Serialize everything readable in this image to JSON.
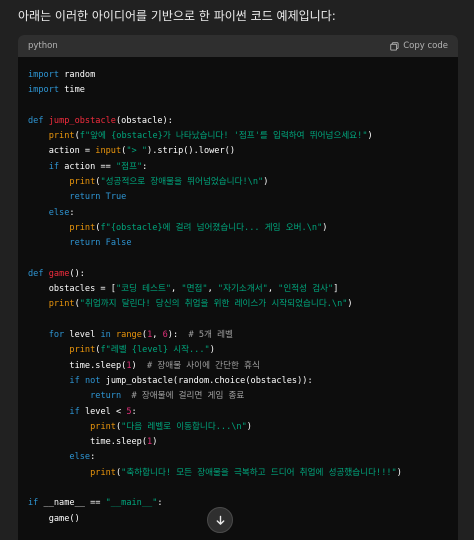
{
  "intro": "아래는 이러한 아이디어를 기반으로 한 파이썬 코드 예제입니다:",
  "code_header": {
    "language": "python",
    "copy_label": "Copy code"
  },
  "icons": {
    "copy": "copy-icon",
    "scroll_down": "arrow-down-icon"
  },
  "colors": {
    "keyword": "#2e95d3",
    "function": "#f22c3d",
    "string": "#00a67d",
    "number": "#df3079",
    "builtin": "#e9950c",
    "comment": "#a0a0a0",
    "code_bg": "#0d0d0d",
    "header_bg": "#2f2f2f"
  },
  "code_lines": [
    [
      {
        "t": "kw",
        "v": "import"
      },
      {
        "t": "pl",
        "v": " random"
      }
    ],
    [
      {
        "t": "kw",
        "v": "import"
      },
      {
        "t": "pl",
        "v": " time"
      }
    ],
    [],
    [
      {
        "t": "kw",
        "v": "def"
      },
      {
        "t": "pl",
        "v": " "
      },
      {
        "t": "fn",
        "v": "jump_obstacle"
      },
      {
        "t": "pl",
        "v": "(obstacle):"
      }
    ],
    [
      {
        "t": "pl",
        "v": "    "
      },
      {
        "t": "bi",
        "v": "print"
      },
      {
        "t": "pl",
        "v": "("
      },
      {
        "t": "str",
        "v": "f\"앞에 {obstacle}가 나타났습니다! '점프'를 입력하여 뛰어넘으세요!\""
      },
      {
        "t": "pl",
        "v": ")"
      }
    ],
    [
      {
        "t": "pl",
        "v": "    action = "
      },
      {
        "t": "bi",
        "v": "input"
      },
      {
        "t": "pl",
        "v": "("
      },
      {
        "t": "str",
        "v": "\"> \""
      },
      {
        "t": "pl",
        "v": ").strip().lower()"
      }
    ],
    [
      {
        "t": "pl",
        "v": "    "
      },
      {
        "t": "kw",
        "v": "if"
      },
      {
        "t": "pl",
        "v": " action == "
      },
      {
        "t": "str",
        "v": "\"점프\""
      },
      {
        "t": "pl",
        "v": ":"
      }
    ],
    [
      {
        "t": "pl",
        "v": "        "
      },
      {
        "t": "bi",
        "v": "print"
      },
      {
        "t": "pl",
        "v": "("
      },
      {
        "t": "str",
        "v": "\"성공적으로 장애물을 뛰어넘었습니다!\\n\""
      },
      {
        "t": "pl",
        "v": ")"
      }
    ],
    [
      {
        "t": "pl",
        "v": "        "
      },
      {
        "t": "kw",
        "v": "return"
      },
      {
        "t": "pl",
        "v": " "
      },
      {
        "t": "kw",
        "v": "True"
      }
    ],
    [
      {
        "t": "pl",
        "v": "    "
      },
      {
        "t": "kw",
        "v": "else"
      },
      {
        "t": "pl",
        "v": ":"
      }
    ],
    [
      {
        "t": "pl",
        "v": "        "
      },
      {
        "t": "bi",
        "v": "print"
      },
      {
        "t": "pl",
        "v": "("
      },
      {
        "t": "str",
        "v": "f\"{obstacle}에 걸려 넘어졌습니다... 게임 오버.\\n\""
      },
      {
        "t": "pl",
        "v": ")"
      }
    ],
    [
      {
        "t": "pl",
        "v": "        "
      },
      {
        "t": "kw",
        "v": "return"
      },
      {
        "t": "pl",
        "v": " "
      },
      {
        "t": "kw",
        "v": "False"
      }
    ],
    [],
    [
      {
        "t": "kw",
        "v": "def"
      },
      {
        "t": "pl",
        "v": " "
      },
      {
        "t": "fn",
        "v": "game"
      },
      {
        "t": "pl",
        "v": "():"
      }
    ],
    [
      {
        "t": "pl",
        "v": "    obstacles = ["
      },
      {
        "t": "str",
        "v": "\"코딩 테스트\""
      },
      {
        "t": "pl",
        "v": ", "
      },
      {
        "t": "str",
        "v": "\"면접\""
      },
      {
        "t": "pl",
        "v": ", "
      },
      {
        "t": "str",
        "v": "\"자기소개서\""
      },
      {
        "t": "pl",
        "v": ", "
      },
      {
        "t": "str",
        "v": "\"인적성 검사\""
      },
      {
        "t": "pl",
        "v": "]"
      }
    ],
    [
      {
        "t": "pl",
        "v": "    "
      },
      {
        "t": "bi",
        "v": "print"
      },
      {
        "t": "pl",
        "v": "("
      },
      {
        "t": "str",
        "v": "\"취업까지 달린다! 당신의 취업을 위한 레이스가 시작되었습니다.\\n\""
      },
      {
        "t": "pl",
        "v": ")"
      }
    ],
    [],
    [
      {
        "t": "pl",
        "v": "    "
      },
      {
        "t": "kw",
        "v": "for"
      },
      {
        "t": "pl",
        "v": " level "
      },
      {
        "t": "kw",
        "v": "in"
      },
      {
        "t": "pl",
        "v": " "
      },
      {
        "t": "bi",
        "v": "range"
      },
      {
        "t": "pl",
        "v": "("
      },
      {
        "t": "num",
        "v": "1"
      },
      {
        "t": "pl",
        "v": ", "
      },
      {
        "t": "num",
        "v": "6"
      },
      {
        "t": "pl",
        "v": "):  "
      },
      {
        "t": "cm",
        "v": "# 5개 레벨"
      }
    ],
    [
      {
        "t": "pl",
        "v": "        "
      },
      {
        "t": "bi",
        "v": "print"
      },
      {
        "t": "pl",
        "v": "("
      },
      {
        "t": "str",
        "v": "f\"레벨 {level} 시작...\""
      },
      {
        "t": "pl",
        "v": ")"
      }
    ],
    [
      {
        "t": "pl",
        "v": "        time.sleep("
      },
      {
        "t": "num",
        "v": "1"
      },
      {
        "t": "pl",
        "v": ")  "
      },
      {
        "t": "cm",
        "v": "# 장애물 사이에 간단한 휴식"
      }
    ],
    [
      {
        "t": "pl",
        "v": "        "
      },
      {
        "t": "kw",
        "v": "if"
      },
      {
        "t": "pl",
        "v": " "
      },
      {
        "t": "kw",
        "v": "not"
      },
      {
        "t": "pl",
        "v": " jump_obstacle(random.choice(obstacles)):"
      }
    ],
    [
      {
        "t": "pl",
        "v": "            "
      },
      {
        "t": "kw",
        "v": "return"
      },
      {
        "t": "pl",
        "v": "  "
      },
      {
        "t": "cm",
        "v": "# 장애물에 걸리면 게임 종료"
      }
    ],
    [
      {
        "t": "pl",
        "v": "        "
      },
      {
        "t": "kw",
        "v": "if"
      },
      {
        "t": "pl",
        "v": " level < "
      },
      {
        "t": "num",
        "v": "5"
      },
      {
        "t": "pl",
        "v": ":"
      }
    ],
    [
      {
        "t": "pl",
        "v": "            "
      },
      {
        "t": "bi",
        "v": "print"
      },
      {
        "t": "pl",
        "v": "("
      },
      {
        "t": "str",
        "v": "\"다음 레벨로 이동합니다...\\n\""
      },
      {
        "t": "pl",
        "v": ")"
      }
    ],
    [
      {
        "t": "pl",
        "v": "            time.sleep("
      },
      {
        "t": "num",
        "v": "1"
      },
      {
        "t": "pl",
        "v": ")"
      }
    ],
    [
      {
        "t": "pl",
        "v": "        "
      },
      {
        "t": "kw",
        "v": "else"
      },
      {
        "t": "pl",
        "v": ":"
      }
    ],
    [
      {
        "t": "pl",
        "v": "            "
      },
      {
        "t": "bi",
        "v": "print"
      },
      {
        "t": "pl",
        "v": "("
      },
      {
        "t": "str",
        "v": "\"축하합니다! 모든 장애물을 극복하고 드디어 취업에 성공했습니다!!!\""
      },
      {
        "t": "pl",
        "v": ")"
      }
    ],
    [],
    [
      {
        "t": "kw",
        "v": "if"
      },
      {
        "t": "pl",
        "v": " __name__ == "
      },
      {
        "t": "str",
        "v": "\"__main__\""
      },
      {
        "t": "pl",
        "v": ":"
      }
    ],
    [
      {
        "t": "pl",
        "v": "    game()"
      }
    ]
  ]
}
